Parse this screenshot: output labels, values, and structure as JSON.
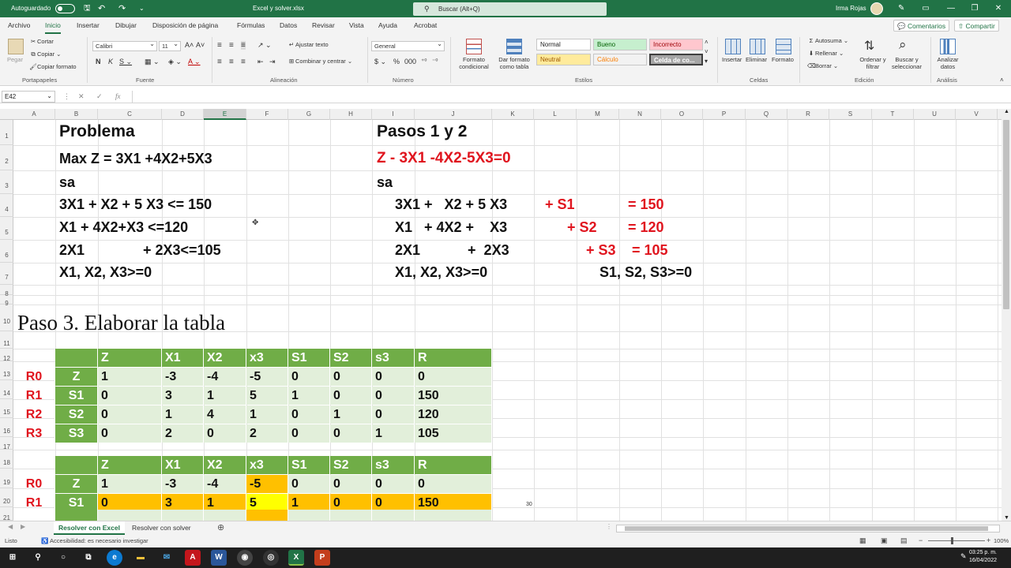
{
  "titlebar": {
    "autosave_label": "Autoguardado",
    "file_name": "Excel y solver.xlsx",
    "search_placeholder": "Buscar (Alt+Q)",
    "user_name": "Irma Rojas"
  },
  "menu": {
    "items": [
      "Archivo",
      "Inicio",
      "Insertar",
      "Dibujar",
      "Disposición de página",
      "Fórmulas",
      "Datos",
      "Revisar",
      "Vista",
      "Ayuda",
      "Acrobat"
    ],
    "active": "Inicio",
    "comments_label": "Comentarios",
    "share_label": "Compartir"
  },
  "ribbon": {
    "clipboard": {
      "paste": "Pegar",
      "cut": "Cortar",
      "copy": "Copiar",
      "format_painter": "Copiar formato",
      "group": "Portapapeles"
    },
    "font": {
      "name": "Calibri",
      "size": "11",
      "group": "Fuente"
    },
    "alignment": {
      "wrap": "Ajustar texto",
      "merge": "Combinar y centrar",
      "group": "Alineación"
    },
    "number": {
      "format": "General",
      "group": "Número"
    },
    "styles": {
      "conditional": "Formato condicional",
      "as_table": "Dar formato como tabla",
      "normal": "Normal",
      "good": "Bueno",
      "bad": "Incorrecto",
      "neutral": "Neutral",
      "calc": "Cálculo",
      "check": "Celda de co...",
      "group": "Estilos"
    },
    "cells": {
      "insert": "Insertar",
      "delete": "Eliminar",
      "format": "Formato",
      "group": "Celdas"
    },
    "editing": {
      "autosum": "Autosuma",
      "fill": "Rellenar",
      "clear": "Borrar",
      "sort": "Ordenar y filtrar",
      "find": "Buscar y seleccionar",
      "group": "Edición"
    },
    "analysis": {
      "analyze": "Analizar datos",
      "group": "Análisis"
    }
  },
  "formula_bar": {
    "name_box": "E42",
    "content": ""
  },
  "columns": [
    "A",
    "B",
    "C",
    "D",
    "E",
    "F",
    "G",
    "H",
    "I",
    "J",
    "K",
    "L",
    "M",
    "N",
    "O",
    "P",
    "Q",
    "R",
    "S",
    "T",
    "U",
    "V"
  ],
  "rows": [
    "1",
    "2",
    "3",
    "4",
    "5",
    "6",
    "7",
    "8",
    "9",
    "10",
    "11",
    "12",
    "13",
    "14",
    "15",
    "16",
    "17",
    "18",
    "19",
    "20",
    "21"
  ],
  "problem": {
    "title": "Problema",
    "objective": "Max Z = 3X1 +4X2+5X3",
    "sa": "sa",
    "c1": "3X1 + X2 + 5 X3 <= 150",
    "c2": "X1 + 4X2+X3 <=120",
    "c3_a": "2X1",
    "c3_b": "+ 2X3<=105",
    "nonneg": "X1, X2, X3>=0"
  },
  "steps": {
    "title": "Pasos 1 y 2",
    "objective": "Z - 3X1 -4X2-5X3=0",
    "sa": "sa",
    "c1_a": "3X1 +   X2 + 5 X3",
    "c1_s": "+ S1",
    "c1_r": "= 150",
    "c2_a": "X1   + 4X2 +    X3",
    "c2_s": "+ S2",
    "c2_r": "= 120",
    "c3_a": "2X1            +  2X3",
    "c3_s": "+ S3",
    "c3_r": "= 105",
    "nonneg": "X1, X2, X3>=0",
    "slack_nonneg": "S1, S2, S3>=0"
  },
  "paso3": "Paso 3. Elaborar la tabla",
  "table1": {
    "header": [
      "Z",
      "X1",
      "X2",
      "x3",
      "S1",
      "S2",
      "s3",
      "R"
    ],
    "rows": [
      {
        "label": "R0",
        "basic": "Z",
        "values": [
          "1",
          "-3",
          "-4",
          "-5",
          "0",
          "0",
          "0",
          "0"
        ]
      },
      {
        "label": "R1",
        "basic": "S1",
        "values": [
          "0",
          "3",
          "1",
          "5",
          "1",
          "0",
          "0",
          "150"
        ]
      },
      {
        "label": "R2",
        "basic": "S2",
        "values": [
          "0",
          "1",
          "4",
          "1",
          "0",
          "1",
          "0",
          "120"
        ]
      },
      {
        "label": "R3",
        "basic": "S3",
        "values": [
          "0",
          "2",
          "0",
          "2",
          "0",
          "0",
          "1",
          "105"
        ]
      }
    ]
  },
  "table2": {
    "header": [
      "Z",
      "X1",
      "X2",
      "x3",
      "S1",
      "S2",
      "s3",
      "R"
    ],
    "rows": [
      {
        "label": "R0",
        "basic": "Z",
        "values": [
          "1",
          "-3",
          "-4",
          "-5",
          "0",
          "0",
          "0",
          "0"
        ]
      },
      {
        "label": "R1",
        "basic": "S1",
        "values": [
          "0",
          "3",
          "1",
          "5",
          "1",
          "0",
          "0",
          "150"
        ]
      }
    ],
    "stray_value": "30"
  },
  "sheets": [
    "Resolver con Excel",
    "Resolver con solver"
  ],
  "active_sheet": "Resolver con Excel",
  "status": {
    "ready": "Listo",
    "accessibility": "Accesibilidad: es necesario investigar",
    "zoom": "100%"
  },
  "taskbar": {
    "time": "03:25 p. m.",
    "date": "16/04/2022"
  },
  "colors": {
    "excel_green": "#217346",
    "table_green": "#70ad47",
    "light_green": "#e2efda",
    "highlight_orange": "#ffc000",
    "highlight_yellow": "#ffff00",
    "red": "#e0141e"
  }
}
